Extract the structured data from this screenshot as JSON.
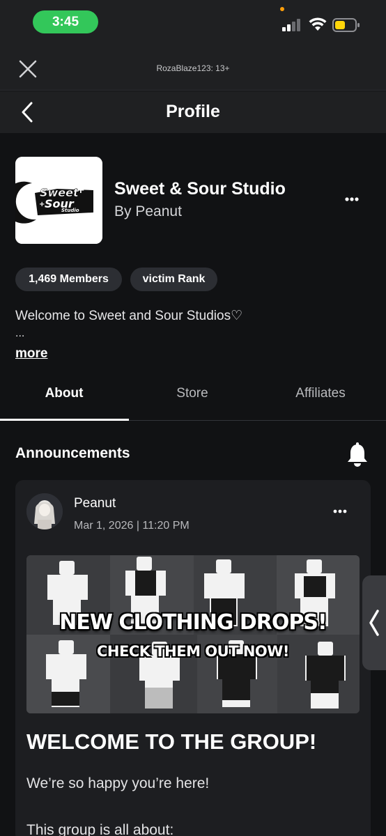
{
  "status_bar": {
    "time": "3:45",
    "icons": [
      "signal-icon",
      "wifi-icon",
      "battery-icon"
    ],
    "time_pill_color": "#33c75a",
    "battery_color": "#ffd60a"
  },
  "web_header": {
    "title": "RozaBlaze123: 13+",
    "close_icon": "close-icon"
  },
  "header": {
    "title": "Profile",
    "back_icon": "chevron-left-icon"
  },
  "group": {
    "name": "Sweet & Sour Studio",
    "by": "By Peanut",
    "logo_text_1": "Sweet",
    "logo_text_2": "Sour",
    "logo_text_3": "Studio",
    "members": "1,469 Members",
    "rank": "victim Rank",
    "description": "Welcome to Sweet and Sour Studios♡",
    "description_ellipsis": "...",
    "more_label": "more"
  },
  "tabs": [
    {
      "label": "About",
      "active": true
    },
    {
      "label": "Store",
      "active": false
    },
    {
      "label": "Affiliates",
      "active": false
    }
  ],
  "announcements": {
    "title": "Announcements",
    "bell_icon": "bell-icon",
    "post": {
      "author": "Peanut",
      "date": "Mar 1, 2026 | 11:20 PM",
      "banner_headline": "NEW CLOTHING DROPS!",
      "banner_sub": "CHECK THEM OUT NOW!",
      "heading": "WELCOME TO THE GROUP!",
      "line1": "We’re so happy you’re here!",
      "line2": "This group is all about:"
    }
  }
}
